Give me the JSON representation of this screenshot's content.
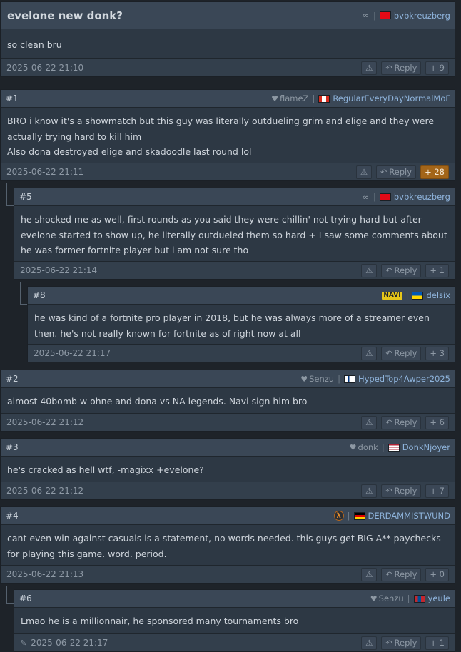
{
  "topic": {
    "title": "evelone new donk?",
    "user": "bvbkreuzberg",
    "flag": "tr",
    "body": "so clean bru",
    "date": "2025-06-22 21:10",
    "reply_label": "Reply",
    "frags": "+ 9"
  },
  "posts": [
    {
      "num": "#1",
      "fav": "flameZ",
      "user": "RegularEveryDayNormalMoF",
      "flag": "us-ca",
      "body": "BRO i know it's a showmatch but this guy was literally outdueling grim and elige and they were actually trying hard to kill him\nAlso dona destroyed elige and skadoodle last round lol",
      "date": "2025-06-22 21:11",
      "reply_label": "Reply",
      "frags": "+ 28"
    },
    {
      "num": "#5",
      "user": "bvbkreuzberg",
      "flag": "tr",
      "body": "he shocked me as well, first rounds as you said they were chillin' not trying hard but after evelone started to show up, he literally outdueled them so hard + I saw some comments about he was former fortnite player but i am not sure tho",
      "date": "2025-06-22 21:14",
      "reply_label": "Reply",
      "frags": "+ 1"
    },
    {
      "num": "#8",
      "fav_team": "NAVI",
      "user": "delsix",
      "flag": "ua",
      "body": "he was kind of a fortnite pro player in 2018, but he was always more of a streamer even then. he's not really known for fortnite as of right now at all",
      "date": "2025-06-22 21:17",
      "reply_label": "Reply",
      "frags": "+ 3"
    },
    {
      "num": "#2",
      "fav": "Senzu",
      "user": "HypedTop4Awper2025",
      "flag": "fi",
      "body": "almost 40bomb w ohne and dona vs NA legends. Navi sign him bro",
      "date": "2025-06-22 21:12",
      "reply_label": "Reply",
      "frags": "+ 6"
    },
    {
      "num": "#3",
      "fav": "donk",
      "user": "DonkNjoyer",
      "flag": "us",
      "body": "he's cracked as hell wtf, -magixx +evelone?",
      "date": "2025-06-22 21:12",
      "reply_label": "Reply",
      "frags": "+ 7"
    },
    {
      "num": "#4",
      "fav_icon": "λ",
      "user": "DERDAMMISTWUND",
      "flag": "de",
      "body": "cant even win against casuals is a statement, no words needed. this guys get BIG A** paychecks for playing this game. word. period.",
      "date": "2025-06-22 21:13",
      "reply_label": "Reply",
      "frags": "+ 0"
    },
    {
      "num": "#6",
      "fav": "Senzu",
      "user": "yeule",
      "flag": "mn",
      "body": "Lmao he is a millionnair, he sponsored many tournaments bro",
      "date": "2025-06-22 21:17",
      "reply_label": "Reply",
      "frags": "+ 1"
    }
  ],
  "icons": {
    "warn": "⚠",
    "reply": "↶",
    "heart": "♥",
    "pencil": "✎",
    "infinity": "∞"
  },
  "colors": {
    "background": "#1e2329",
    "post_bg": "#2d3844",
    "header_bg": "#3a4756",
    "username": "#8fb4dc",
    "frag_hot": "#a36519"
  }
}
